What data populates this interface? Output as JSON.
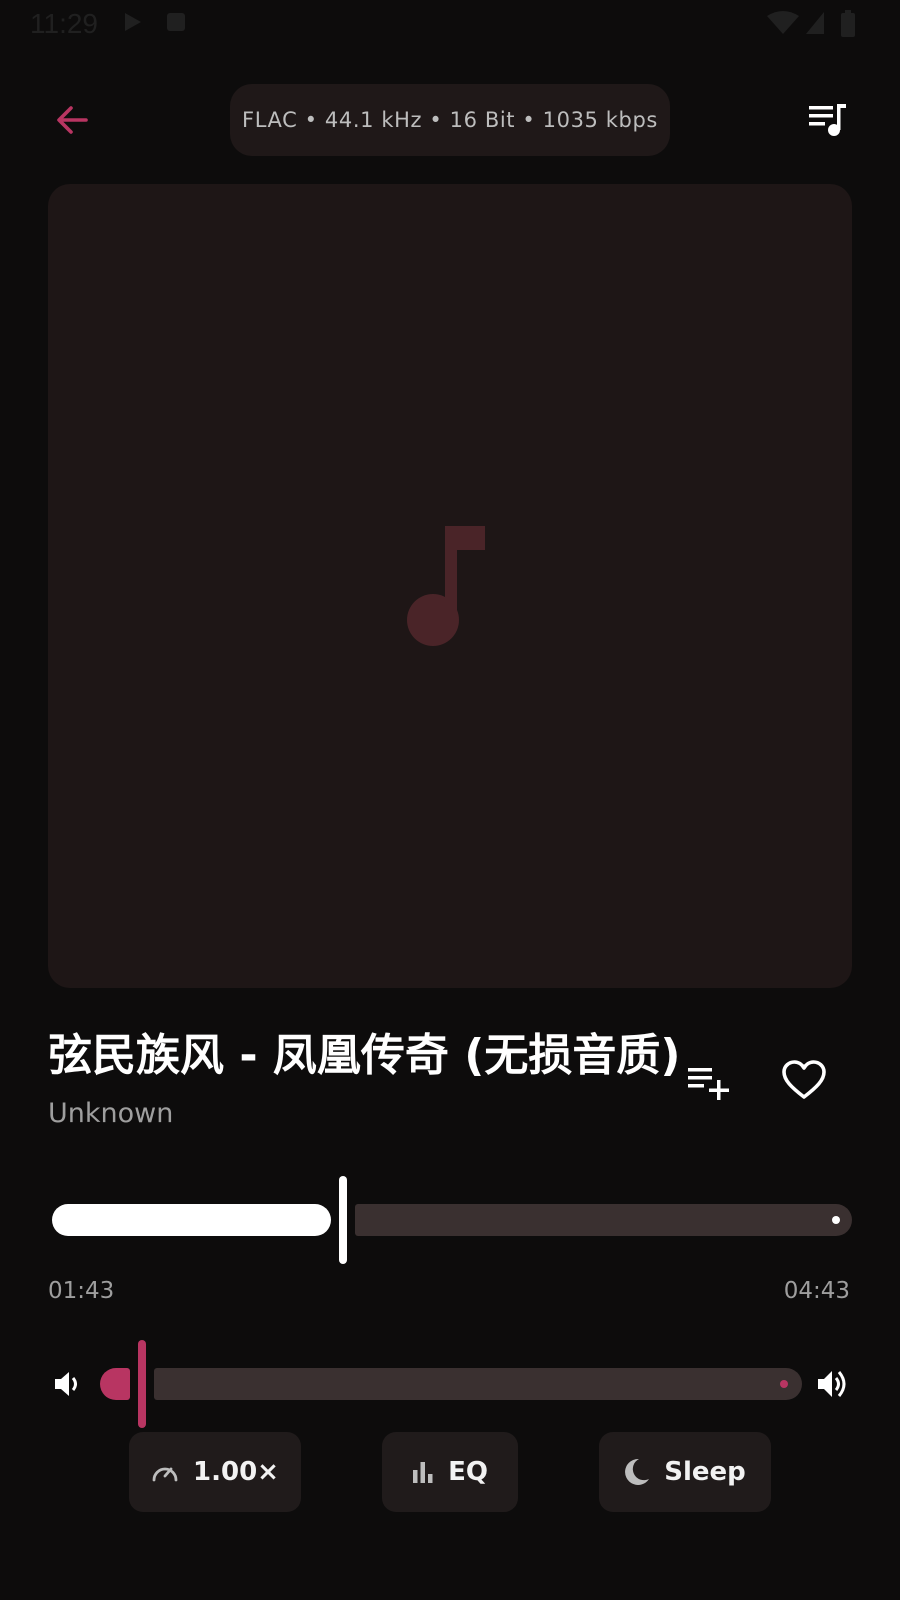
{
  "status_bar": {
    "time": "11:29"
  },
  "header": {
    "audio_format": "FLAC • 44.1 kHz • 16 Bit • 1035 kbps",
    "back_icon": "arrow-back-icon",
    "queue_icon": "queue-music-icon"
  },
  "track": {
    "title": "弦民族风 - 凤凰传奇 (无损音质)",
    "artist": "Unknown"
  },
  "playback": {
    "elapsed": "01:43",
    "duration": "04:43",
    "progress_fraction": 0.364
  },
  "volume": {
    "level_fraction": 0.06
  },
  "controls": {
    "speed_label": "1.00×",
    "eq_label": "EQ",
    "sleep_label": "Sleep"
  },
  "colors": {
    "accent": "#b83562",
    "background": "#0d0c0c",
    "surface": "#201b1b",
    "artwork_bg": "#1e1616"
  }
}
